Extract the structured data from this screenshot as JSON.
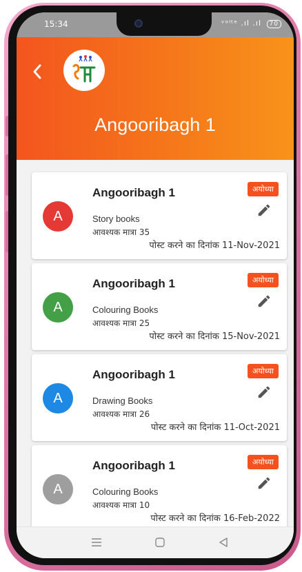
{
  "status_bar": {
    "time": "15:34",
    "icons_text": "ᵛᵒˡᵗᵉ .ıl .ıl",
    "battery": "70"
  },
  "header": {
    "back_icon": "chevron-left-icon",
    "title": "Angooribagh 1",
    "gradient_start": "#f4551e",
    "gradient_end": "#f8931a"
  },
  "cards": [
    {
      "avatar_letter": "A",
      "avatar_color": "#e53935",
      "title": "Angooribagh 1",
      "item": "Story books",
      "quantity": "आवश्यक मात्रा 35",
      "date": "पोस्ट करने का दिनांक  11-Nov-2021",
      "badge": "अयोध्या"
    },
    {
      "avatar_letter": "A",
      "avatar_color": "#43a047",
      "title": "Angooribagh 1",
      "item": "Colouring Books",
      "quantity": "आवश्यक मात्रा 25",
      "date": "पोस्ट करने का दिनांक  15-Nov-2021",
      "badge": "अयोध्या"
    },
    {
      "avatar_letter": "A",
      "avatar_color": "#1e88e5",
      "title": "Angooribagh 1",
      "item": "Drawing Books",
      "quantity": "आवश्यक मात्रा 26",
      "date": "पोस्ट करने का दिनांक  11-Oct-2021",
      "badge": "अयोध्या"
    },
    {
      "avatar_letter": "A",
      "avatar_color": "#9e9e9e",
      "title": "Angooribagh 1",
      "item": "Colouring Books",
      "quantity": "आवश्यक मात्रा 10",
      "date": "पोस्ट करने का दिनांक  16-Feb-2022",
      "badge": "अयोध्या"
    }
  ],
  "badge_color": "#f4511e",
  "nav": {
    "menu_icon": "menu-icon",
    "home_icon": "home-square-icon",
    "back_icon": "back-triangle-icon"
  }
}
